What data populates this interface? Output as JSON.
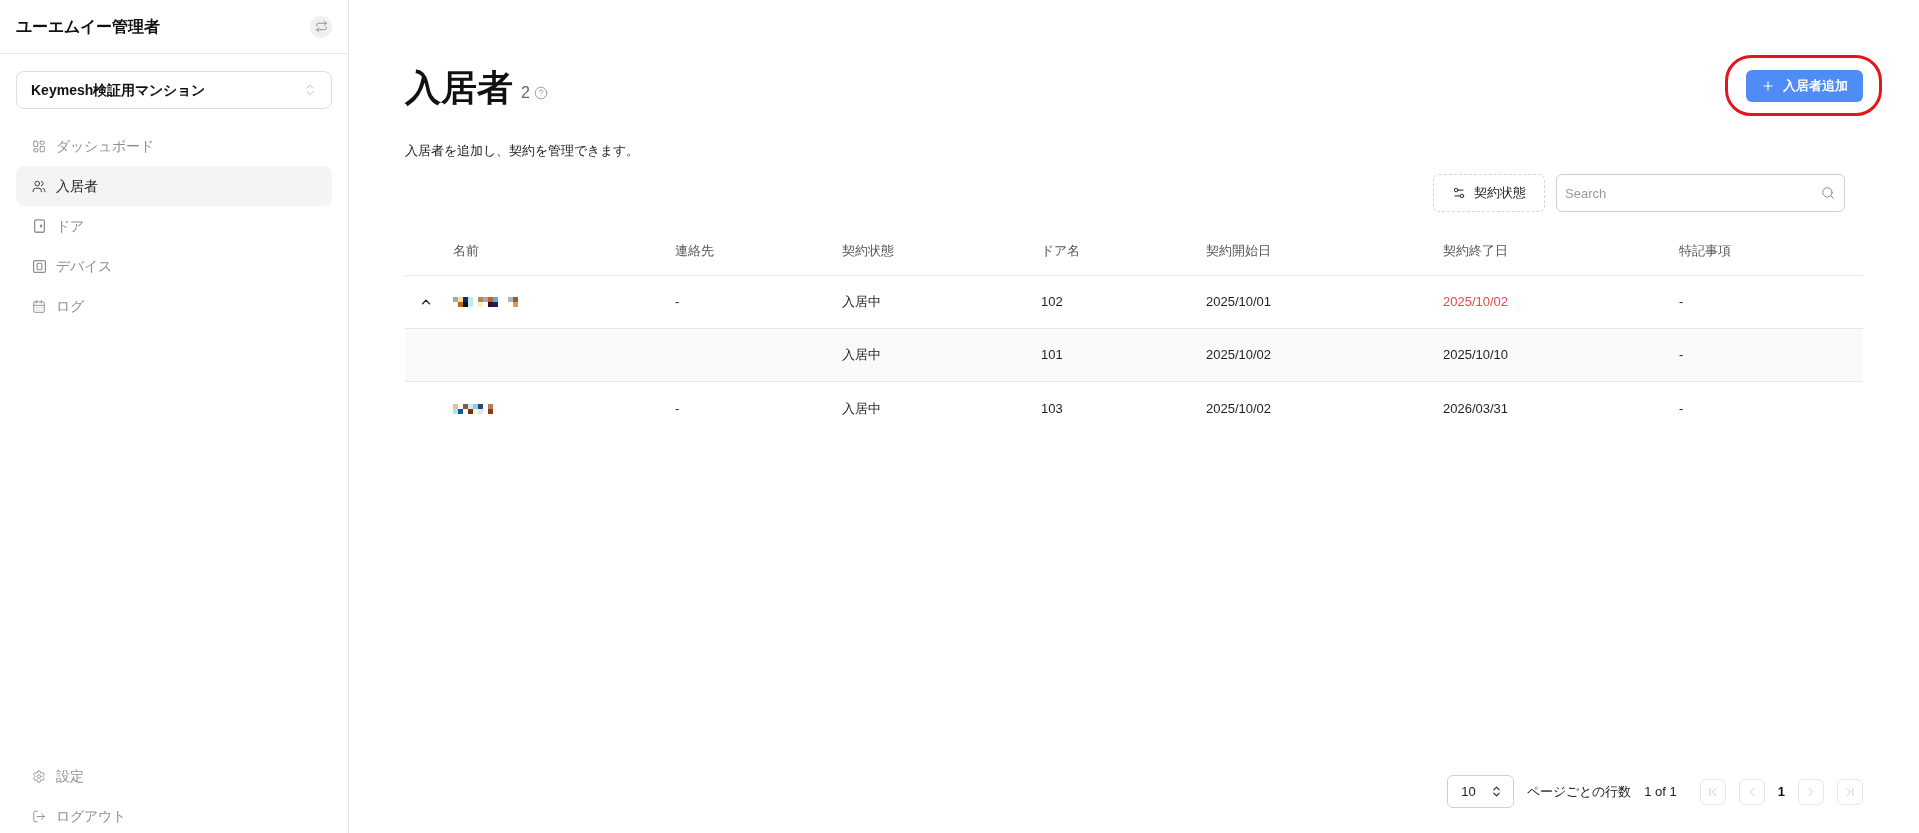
{
  "sidebar": {
    "title": "ユーエムイー管理者",
    "property_selector": {
      "value": "Keymesh検証用マンション"
    },
    "nav_items": [
      {
        "label": "ダッシュボード",
        "selected": false
      },
      {
        "label": "入居者",
        "selected": true
      },
      {
        "label": "ドア",
        "selected": false
      },
      {
        "label": "デバイス",
        "selected": false
      },
      {
        "label": "ログ",
        "selected": false
      }
    ],
    "footer_items": [
      {
        "label": "設定"
      },
      {
        "label": "ログアウト"
      }
    ]
  },
  "page": {
    "title": "入居者",
    "count": "2",
    "description": "入居者を追加し、契約を管理できます。",
    "add_button": {
      "label": "入居者追加",
      "annotated": true
    }
  },
  "toolbar": {
    "filter_button": {
      "label": "契約状態"
    },
    "search": {
      "placeholder": "Search"
    }
  },
  "table": {
    "columns": [
      "名前",
      "連絡先",
      "契約状態",
      "ドア名",
      "契約開始日",
      "契約終了日",
      "特記事項"
    ],
    "rows": [
      {
        "name_pixelated": true,
        "contact": "-",
        "status": "入居中",
        "door": "102",
        "start": "2025/10/01",
        "end": "2025/10/02",
        "end_overdue": true,
        "notes": "-",
        "expanded": true,
        "children": [
          {
            "status": "入居中",
            "door": "101",
            "start": "2025/10/02",
            "end": "2025/10/10",
            "end_overdue": false,
            "notes": "-"
          }
        ]
      },
      {
        "name_pixelated": true,
        "contact": "-",
        "status": "入居中",
        "door": "103",
        "start": "2025/10/02",
        "end": "2026/03/31",
        "end_overdue": false,
        "notes": "-"
      }
    ]
  },
  "pagination": {
    "page_size": "10",
    "page_size_label": "ページごとの行数",
    "range": "1 of 1",
    "controls": [
      {
        "kind": "first",
        "disabled": true
      },
      {
        "kind": "previous",
        "disabled": true
      },
      {
        "kind": "page",
        "label": "1",
        "selected": true
      },
      {
        "kind": "next",
        "disabled": true
      },
      {
        "kind": "last",
        "disabled": true
      }
    ]
  }
}
